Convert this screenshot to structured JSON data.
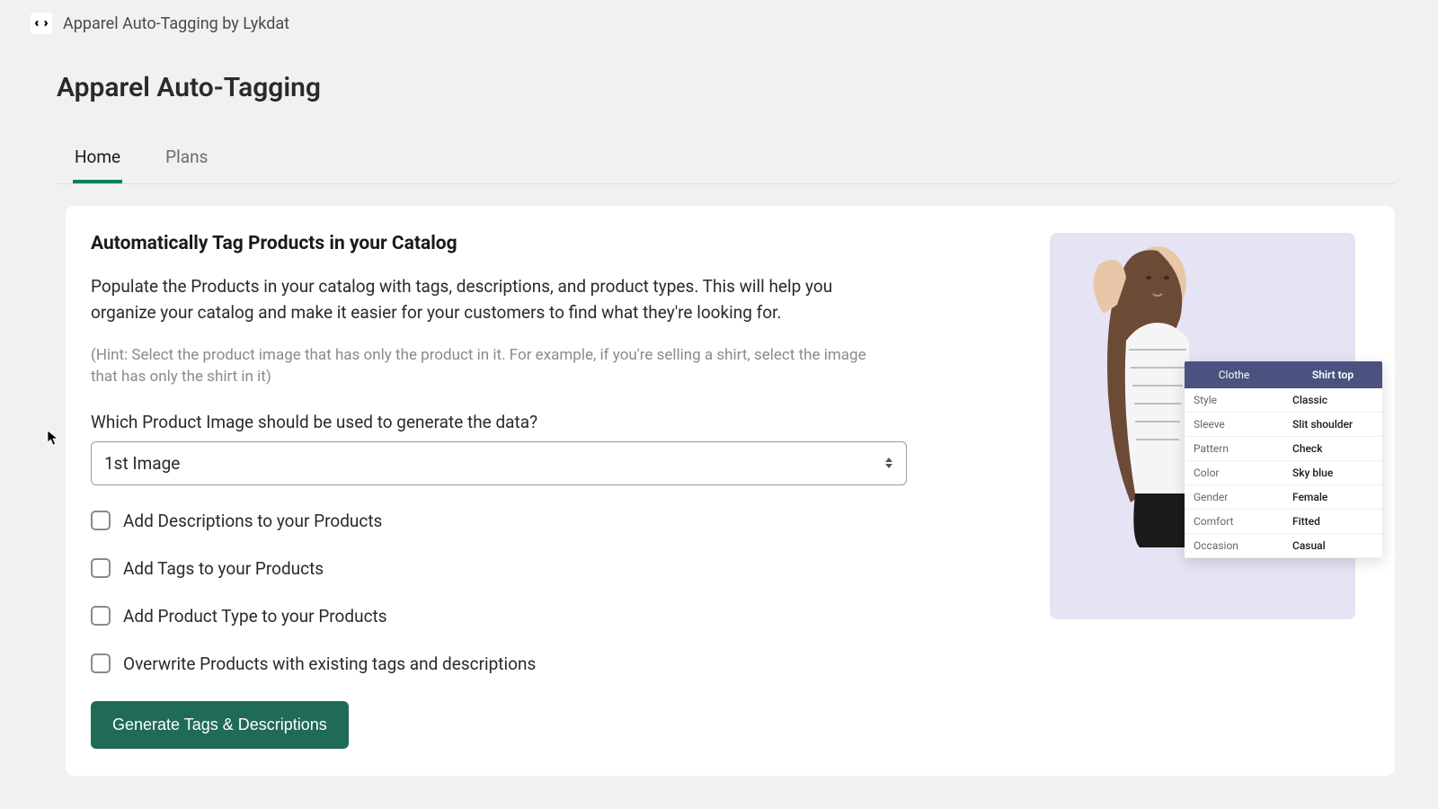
{
  "header": {
    "app_name": "Apparel Auto-Tagging by Lykdat"
  },
  "page": {
    "title": "Apparel Auto-Tagging",
    "tabs": [
      {
        "label": "Home",
        "active": true
      },
      {
        "label": "Plans",
        "active": false
      }
    ]
  },
  "main": {
    "heading": "Automatically Tag Products in your Catalog",
    "description": "Populate the Products in your catalog with tags, descriptions, and product types. This will help you organize your catalog and make it easier for your customers to find what they're looking for.",
    "hint": "(Hint: Select the product image that has only the product in it. For example, if you're selling a shirt, select the image that has only the shirt in it)",
    "image_select": {
      "label": "Which Product Image should be used to generate the data?",
      "value": "1st Image"
    },
    "options": [
      {
        "label": "Add Descriptions to your Products",
        "checked": false
      },
      {
        "label": "Add Tags to your Products",
        "checked": false
      },
      {
        "label": "Add Product Type to your Products",
        "checked": false
      },
      {
        "label": "Overwrite Products with existing tags and descriptions",
        "checked": false
      }
    ],
    "generate_button": "Generate Tags & Descriptions"
  },
  "preview": {
    "header": {
      "left": "Clothe",
      "right": "Shirt top"
    },
    "rows": [
      {
        "attr": "Style",
        "val": "Classic"
      },
      {
        "attr": "Sleeve",
        "val": "Slit shoulder"
      },
      {
        "attr": "Pattern",
        "val": "Check"
      },
      {
        "attr": "Color",
        "val": "Sky blue"
      },
      {
        "attr": "Gender",
        "val": "Female"
      },
      {
        "attr": "Comfort",
        "val": "Fitted"
      },
      {
        "attr": "Occasion",
        "val": "Casual"
      }
    ]
  }
}
